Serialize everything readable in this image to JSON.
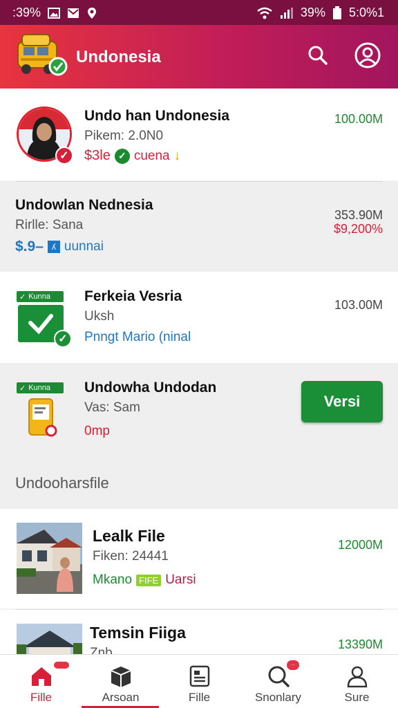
{
  "status_bar": {
    "left_text": ":39%",
    "battery": "39%",
    "time": "5:0%1",
    "icons": [
      "image-icon",
      "mail-icon",
      "location-icon",
      "wifi-icon",
      "signal-icon",
      "battery-icon"
    ]
  },
  "app_bar": {
    "title": "Undonesia",
    "logo_icon": "taxi-logo-icon",
    "actions": [
      "search-icon",
      "account-icon"
    ]
  },
  "colors": {
    "brand_gradient": [
      "#e8343f",
      "#c21e57",
      "#a2155e"
    ],
    "positive": "#1a8a2e",
    "negative": "#d6203a",
    "accent_blue": "#1f77c4",
    "verify_button": "#1a8f38"
  },
  "items": [
    {
      "title": "Undo han Undonesia",
      "subtitle": "Pikem: 2.0N0",
      "meta_a": "$3le",
      "meta_b": "cuena",
      "amount": "100.00M"
    },
    {
      "title": "Undowlan Nednesia",
      "subtitle": "Rirlle: Sana",
      "meta_a": "$.9–",
      "meta_b": "uunnai",
      "amount_top": "353.90M",
      "amount_bottom": "$9,200%"
    },
    {
      "tag": "Kunna",
      "title": "Ferkeia Vesria",
      "subtitle": "Uksh",
      "meta": "Pnngt Mario (ninal",
      "amount": "103.00M"
    },
    {
      "tag": "Kunna",
      "title": "Undowha Undodan",
      "subtitle": "Vas: Sam",
      "meta": "0mp",
      "button": "Versi"
    }
  ],
  "section_header": "Undooharsfile",
  "files": [
    {
      "title": "Lealk File",
      "subtitle": "Fiken: 24441",
      "meta_a": "Mkano",
      "meta_badge": "FIFE",
      "meta_b": "Uarsi",
      "amount": "12000M"
    },
    {
      "title": "Temsin Fiiga",
      "subtitle": "Znb",
      "amount": "13390M"
    }
  ],
  "bottom_nav": [
    {
      "label": "Fille",
      "icon": "home-icon",
      "active": true
    },
    {
      "label": "Arsoan",
      "icon": "box-icon",
      "active": false
    },
    {
      "label": "Fille",
      "icon": "document-icon",
      "active": false
    },
    {
      "label": "Snonlary",
      "icon": "search-icon",
      "active": false,
      "badge": "··"
    },
    {
      "label": "Sure",
      "icon": "person-icon",
      "active": false
    }
  ]
}
